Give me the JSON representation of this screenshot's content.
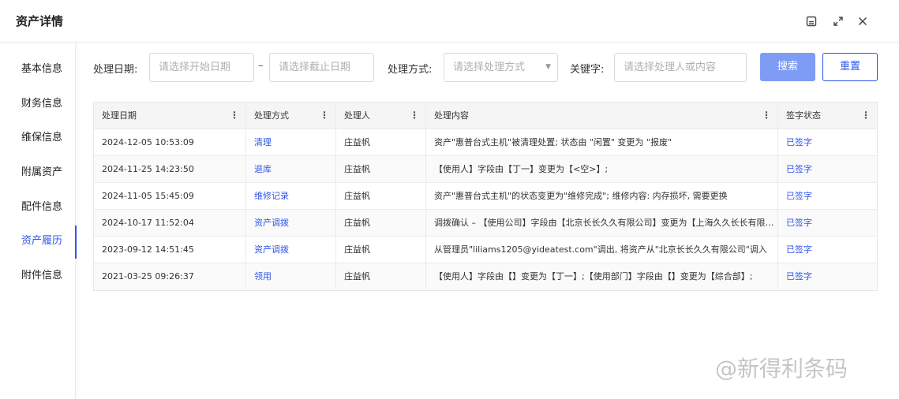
{
  "window": {
    "title": "资产详情",
    "icons": [
      "minimize-panel-icon",
      "expand-icon",
      "close-icon"
    ]
  },
  "sidebar": {
    "items": [
      {
        "label": "基本信息",
        "active": false
      },
      {
        "label": "财务信息",
        "active": false
      },
      {
        "label": "维保信息",
        "active": false
      },
      {
        "label": "附属资产",
        "active": false
      },
      {
        "label": "配件信息",
        "active": false
      },
      {
        "label": "资产履历",
        "active": true
      },
      {
        "label": "附件信息",
        "active": false
      }
    ]
  },
  "filters": {
    "date_label": "处理日期:",
    "start_placeholder": "请选择开始日期",
    "separator": "–",
    "end_placeholder": "请选择截止日期",
    "method_label": "处理方式:",
    "method_placeholder": "请选择处理方式",
    "keyword_label": "关键字:",
    "keyword_placeholder": "请选择处理人或内容",
    "search_label": "搜索",
    "reset_label": "重置"
  },
  "table": {
    "columns": [
      "处理日期",
      "处理方式",
      "处理人",
      "处理内容",
      "签字状态"
    ],
    "rows": [
      {
        "date": "2024-12-05 10:53:09",
        "method": "清理",
        "person": "庄益帆",
        "content": "资产\"惠普台式主机\"被清理处置; 状态由 \"闲置\" 变更为 \"报废\"",
        "status": "已签字"
      },
      {
        "date": "2024-11-25 14:23:50",
        "method": "退库",
        "person": "庄益帆",
        "content": "【使用人】字段由【丁一】变更为【<空>】;",
        "status": "已签字"
      },
      {
        "date": "2024-11-05 15:45:09",
        "method": "维修记录",
        "person": "庄益帆",
        "content": "资产\"惠普台式主机\"的状态变更为\"维修完成\"; 维修内容: 内存损坏, 需要更换",
        "status": "已签字"
      },
      {
        "date": "2024-10-17 11:52:04",
        "method": "资产调拨",
        "person": "庄益帆",
        "content": "调拨确认 – 【使用公司】字段由【北京长长久久有限公司】变更为【上海久久长长有限公司】",
        "status": "已签字"
      },
      {
        "date": "2023-09-12 14:51:45",
        "method": "资产调拨",
        "person": "庄益帆",
        "content": "从管理员\"liliams1205@yideatest.com\"调出, 将资产从\"北京长长久久有限公司\"调入",
        "status": "已签字"
      },
      {
        "date": "2021-03-25 09:26:37",
        "method": "领用",
        "person": "庄益帆",
        "content": "【使用人】字段由【】变更为【丁一】;【使用部门】字段由【】变更为【综合部】;",
        "status": "已签字"
      }
    ]
  },
  "watermark": "@新得利条码",
  "colors": {
    "accent": "#2f54eb",
    "primary_button": "#7f9cf5"
  }
}
